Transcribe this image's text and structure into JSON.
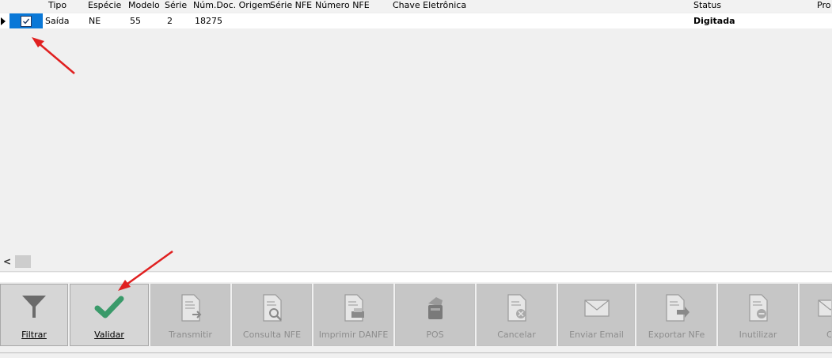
{
  "columns": {
    "tipo": "Tipo",
    "especie": "Espécie",
    "modelo": "Modelo",
    "serie": "Série",
    "num_doc": "Núm.Doc. Origem",
    "serie_nfe": "Série NFE",
    "numero_nfe": "Número NFE",
    "chave": "Chave Eletrônica",
    "status": "Status",
    "pro": "Pro"
  },
  "row": {
    "tipo": "Saída",
    "especie": "NE",
    "modelo": "55",
    "serie": "2",
    "num_doc": "18275",
    "status": "Digitada",
    "checked": true
  },
  "scrollbar": {
    "left_arrow": "<"
  },
  "toolbar": {
    "filtrar": {
      "label": "Filtrar",
      "icon": "funnel-icon"
    },
    "validar": {
      "label": "Validar",
      "icon": "checkmark-icon"
    },
    "transmitir": {
      "label": "Transmitir",
      "icon": "document-send-icon"
    },
    "consulta": {
      "label": "Consulta NFE",
      "icon": "document-search-icon"
    },
    "imprimir": {
      "label": "Imprimir DANFE",
      "icon": "document-print-icon"
    },
    "pos": {
      "label": "POS",
      "icon": "printer-icon"
    },
    "cancelar": {
      "label": "Cancelar",
      "icon": "document-cancel-icon"
    },
    "enviar_email": {
      "label": "Enviar Email",
      "icon": "envelope-icon"
    },
    "exportar": {
      "label": "Exportar NFe",
      "icon": "document-export-icon"
    },
    "inutilizar": {
      "label": "Inutilizar",
      "icon": "document-disable-icon"
    },
    "cut_off": {
      "label": "C",
      "icon": "envelope-icon"
    }
  },
  "colors": {
    "selection": "#0a78d7",
    "check_green": "#3a9a6a",
    "annotation": "#e02020"
  }
}
